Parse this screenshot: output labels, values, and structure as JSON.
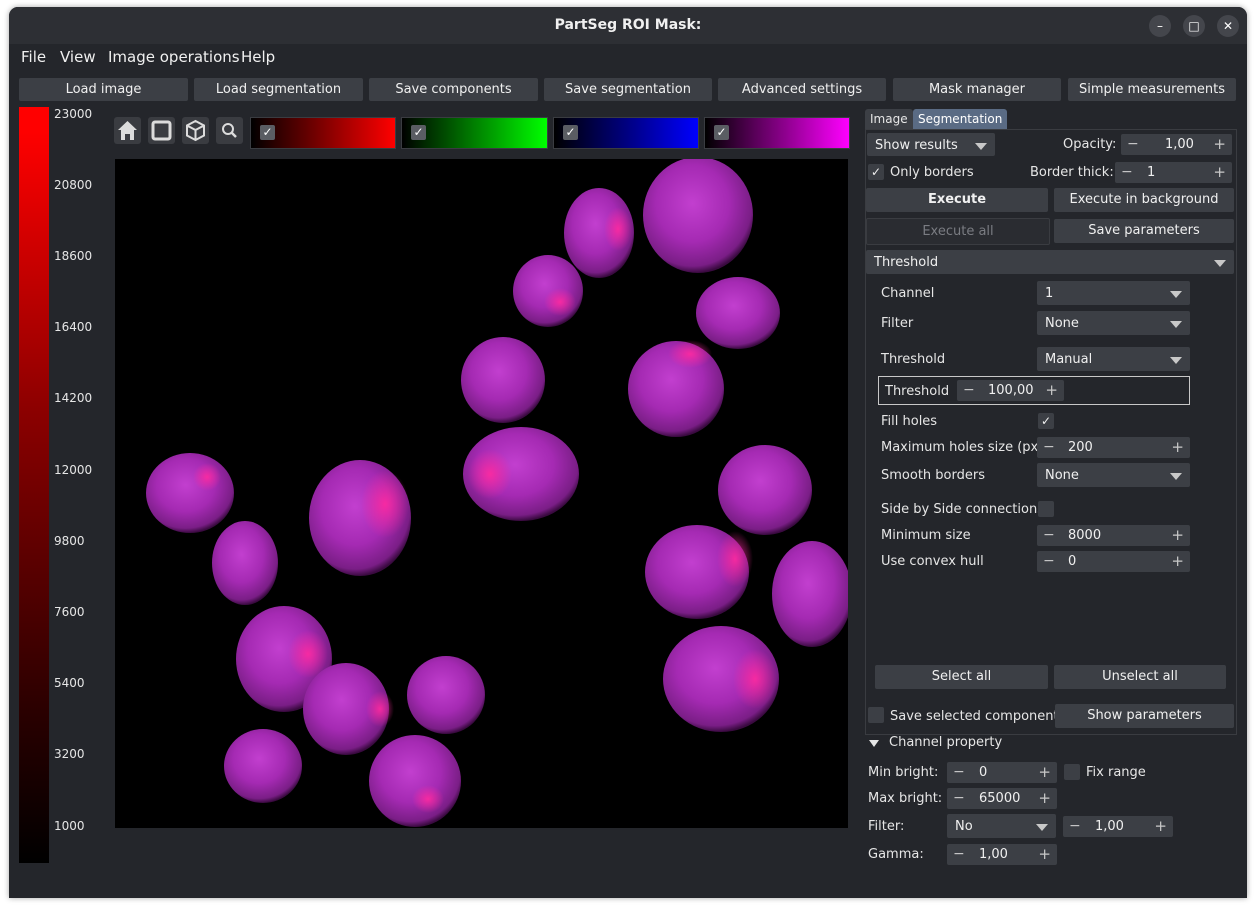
{
  "window": {
    "title": "PartSeg ROI Mask:"
  },
  "menu": [
    "File",
    "View",
    "Image operations",
    "Help"
  ],
  "toolbar": [
    "Load image",
    "Load segmentation",
    "Save components",
    "Save segmentation",
    "Advanced settings",
    "Mask manager",
    "Simple measurements"
  ],
  "colorbar": {
    "ticks": [
      "23000",
      "20800",
      "18600",
      "16400",
      "14200",
      "12000",
      "9800",
      "7600",
      "5400",
      "3200",
      "1000"
    ]
  },
  "viewer": {
    "icons": [
      "home-icon",
      "frame-icon",
      "3d-cube-icon",
      "zoom-icon"
    ],
    "channels": [
      {
        "checked": true,
        "color_from": "#000000",
        "color_to": "#ff0000"
      },
      {
        "checked": true,
        "color_from": "#000000",
        "color_to": "#00ff00"
      },
      {
        "checked": true,
        "color_from": "#000000",
        "color_to": "#0000ff"
      },
      {
        "checked": true,
        "color_from": "#000000",
        "color_to": "#ff00ff"
      }
    ]
  },
  "panel": {
    "tabs": [
      "Image",
      "Segmentation"
    ],
    "active_tab": "Segmentation",
    "show_results": "Show results",
    "opacity_label": "Opacity:",
    "opacity_value": "1,00",
    "only_borders_label": "Only borders",
    "border_thick_label": "Border thick:",
    "border_thick_value": "1",
    "execute": "Execute",
    "execute_bg": "Execute in background",
    "execute_all": "Execute all",
    "save_parameters": "Save parameters",
    "algorithm": "Threshold",
    "params": {
      "channel_label": "Channel",
      "channel_value": "1",
      "filter_label": "Filter",
      "filter_value": "None",
      "threshold_label": "Threshold",
      "threshold_value": "Manual",
      "threshold_inner_label": "Threshold",
      "threshold_inner_value": "100,00",
      "fill_holes_label": "Fill holes",
      "max_holes_label": "Maximum holes size (px)",
      "max_holes_value": "200",
      "smooth_label": "Smooth borders",
      "smooth_value": "None",
      "side_label": "Side by Side connections",
      "min_size_label": "Minimum size",
      "min_size_value": "8000",
      "convex_label": "Use convex hull",
      "convex_value": "0"
    },
    "select_all": "Select all",
    "unselect_all": "Unselect all",
    "save_selected": "Save selected components",
    "show_parameters": "Show parameters"
  },
  "channel_property": {
    "header": "Channel property",
    "min_bright_label": "Min bright:",
    "min_bright_value": "0",
    "fix_range_label": "Fix range",
    "max_bright_label": "Max bright:",
    "max_bright_value": "65000",
    "filter_label": "Filter:",
    "filter_value": "No",
    "filter_num": "1,00",
    "gamma_label": "Gamma:",
    "gamma_value": "1,00"
  }
}
